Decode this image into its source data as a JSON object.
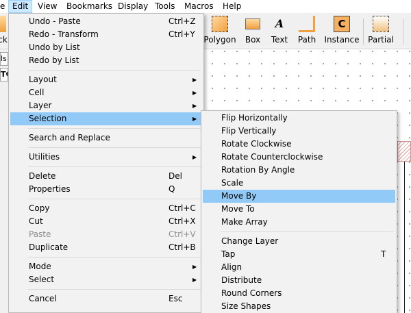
{
  "menubar": {
    "items": [
      {
        "label": "File",
        "fragment": "e"
      },
      {
        "label": "Edit"
      },
      {
        "label": "View"
      },
      {
        "label": "Bookmarks"
      },
      {
        "label": "Display"
      },
      {
        "label": "Tools"
      },
      {
        "label": "Macros"
      },
      {
        "label": "Help"
      }
    ]
  },
  "toolbar": {
    "left_fragment": "ck",
    "tools": [
      {
        "label": "Polygon",
        "icon": "polygon-icon"
      },
      {
        "label": "Box",
        "icon": "box-icon"
      },
      {
        "label": "Text",
        "icon": "text-icon",
        "glyph": "A"
      },
      {
        "label": "Path",
        "icon": "path-icon"
      },
      {
        "label": "Instance",
        "icon": "instance-icon",
        "glyph": "C"
      },
      {
        "label": "Partial",
        "icon": "partial-icon"
      }
    ]
  },
  "left_panel": {
    "tab1": "ls",
    "tab2": "TC"
  },
  "edit_menu": {
    "items": [
      {
        "label": "Undo - Paste",
        "shortcut": "Ctrl+Z"
      },
      {
        "label": "Redo - Transform",
        "shortcut": "Ctrl+Y"
      },
      {
        "label": "Undo by List",
        "shortcut": ""
      },
      {
        "label": "Redo by List",
        "shortcut": ""
      },
      {
        "label": "Layout",
        "submenu": true
      },
      {
        "label": "Cell",
        "submenu": true
      },
      {
        "label": "Layer",
        "submenu": true
      },
      {
        "label": "Selection",
        "submenu": true
      },
      {
        "label": "Search and Replace"
      },
      {
        "label": "Utilities",
        "submenu": true
      },
      {
        "label": "Delete",
        "shortcut": "Del"
      },
      {
        "label": "Properties",
        "shortcut": "Q"
      },
      {
        "label": "Copy",
        "shortcut": "Ctrl+C"
      },
      {
        "label": "Cut",
        "shortcut": "Ctrl+X"
      },
      {
        "label": "Paste",
        "shortcut": "Ctrl+V",
        "disabled": true
      },
      {
        "label": "Duplicate",
        "shortcut": "Ctrl+B"
      },
      {
        "label": "Mode",
        "submenu": true
      },
      {
        "label": "Select",
        "submenu": true
      },
      {
        "label": "Cancel",
        "shortcut": "Esc"
      }
    ]
  },
  "selection_menu": {
    "items": [
      {
        "label": "Flip Horizontally"
      },
      {
        "label": "Flip Vertically"
      },
      {
        "label": "Rotate Clockwise"
      },
      {
        "label": "Rotate Counterclockwise"
      },
      {
        "label": "Rotation By Angle"
      },
      {
        "label": "Scale"
      },
      {
        "label": "Move By"
      },
      {
        "label": "Move To"
      },
      {
        "label": "Make Array"
      },
      {
        "label": "Change Layer"
      },
      {
        "label": "Tap",
        "shortcut": "T"
      },
      {
        "label": "Align"
      },
      {
        "label": "Distribute"
      },
      {
        "label": "Round Corners"
      },
      {
        "label": "Size Shapes"
      }
    ]
  },
  "colors": {
    "highlight": "#91c9f7",
    "menu_active": "#cce8ff",
    "menu_bg": "#f2f2f2"
  }
}
